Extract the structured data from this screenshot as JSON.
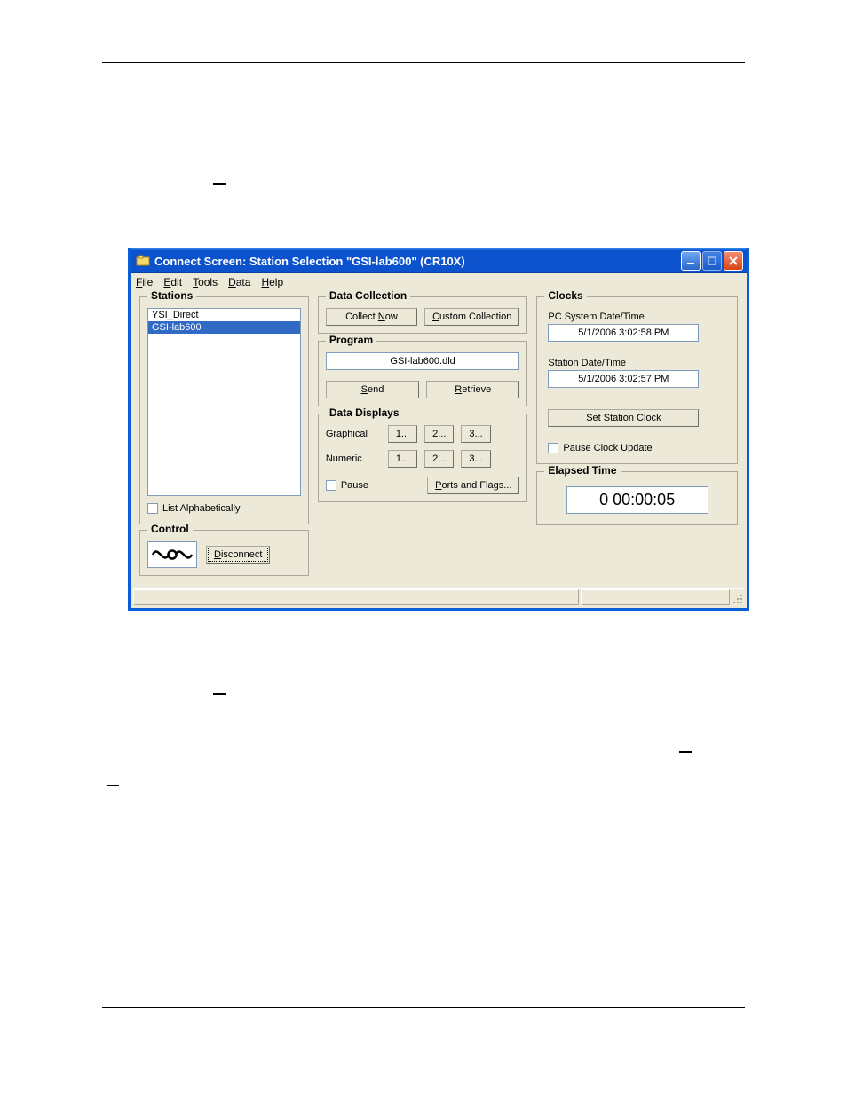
{
  "window": {
    "title": "Connect Screen: Station Selection \"GSI-lab600\" (CR10X)"
  },
  "menu": {
    "file": "File",
    "edit": "Edit",
    "tools": "Tools",
    "data": "Data",
    "help": "Help"
  },
  "stations": {
    "legend": "Stations",
    "items": [
      "YSI_Direct",
      "GSI-lab600"
    ],
    "list_alpha": "List Alphabetically"
  },
  "control": {
    "legend": "Control",
    "disconnect": "Disconnect"
  },
  "data_collection": {
    "legend": "Data Collection",
    "collect_now": "Collect Now",
    "custom": "Custom Collection"
  },
  "program": {
    "legend": "Program",
    "filename": "GSI-lab600.dld",
    "send": "Send",
    "retrieve": "Retrieve"
  },
  "displays": {
    "legend": "Data Displays",
    "graphical": "Graphical",
    "numeric": "Numeric",
    "b1": "1...",
    "b2": "2...",
    "b3": "3...",
    "pause": "Pause",
    "ports_flags": "Ports and Flags..."
  },
  "clocks": {
    "legend": "Clocks",
    "pc_label": "PC System Date/Time",
    "pc_value": "5/1/2006 3:02:58 PM",
    "station_label": "Station Date/Time",
    "station_value": "5/1/2006 3:02:57 PM",
    "set_clock": "Set Station Clock",
    "pause_update": "Pause Clock Update"
  },
  "elapsed": {
    "legend": "Elapsed Time",
    "value": "0 00:00:05"
  }
}
